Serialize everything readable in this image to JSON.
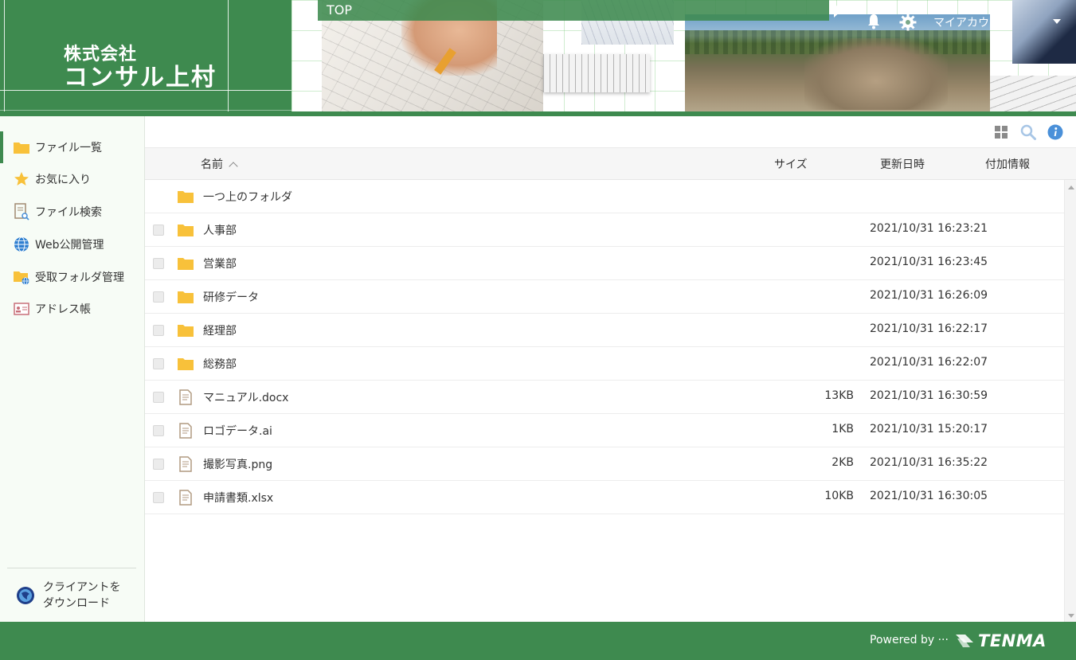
{
  "header": {
    "logo_line1": "株式会社",
    "logo_line2": "コンサル上村",
    "breadcrumb": "TOP",
    "account_label": "マイアカウント"
  },
  "toolbar": {
    "icons": [
      "grid-view-icon",
      "search-icon",
      "info-icon"
    ]
  },
  "sidebar": {
    "items": [
      {
        "label": "ファイル一覧",
        "icon": "folder-icon",
        "active": true
      },
      {
        "label": "お気に入り",
        "icon": "star-icon",
        "active": false
      },
      {
        "label": "ファイル検索",
        "icon": "file-search-icon",
        "active": false
      },
      {
        "label": "Web公開管理",
        "icon": "globe-icon",
        "active": false
      },
      {
        "label": "受取フォルダ管理",
        "icon": "inbox-folder-icon",
        "active": false
      },
      {
        "label": "アドレス帳",
        "icon": "address-book-icon",
        "active": false
      }
    ],
    "client_download_line1": "クライアントを",
    "client_download_line2": "ダウンロード"
  },
  "table": {
    "headers": {
      "name": "名前",
      "size": "サイズ",
      "updated": "更新日時",
      "extra": "付加情報"
    },
    "parent_folder": "一つ上のフォルダ",
    "rows": [
      {
        "type": "folder",
        "name": "人事部",
        "size": "",
        "updated": "2021/10/31 16:23:21"
      },
      {
        "type": "folder",
        "name": "営業部",
        "size": "",
        "updated": "2021/10/31 16:23:45"
      },
      {
        "type": "folder",
        "name": "研修データ",
        "size": "",
        "updated": "2021/10/31 16:26:09"
      },
      {
        "type": "folder",
        "name": "経理部",
        "size": "",
        "updated": "2021/10/31 16:22:17"
      },
      {
        "type": "folder",
        "name": "総務部",
        "size": "",
        "updated": "2021/10/31 16:22:07"
      },
      {
        "type": "file",
        "name": "マニュアル.docx",
        "size": "13KB",
        "updated": "2021/10/31 16:30:59"
      },
      {
        "type": "file",
        "name": "ロゴデータ.ai",
        "size": "1KB",
        "updated": "2021/10/31 15:20:17"
      },
      {
        "type": "file",
        "name": "撮影写真.png",
        "size": "2KB",
        "updated": "2021/10/31 16:35:22"
      },
      {
        "type": "file",
        "name": "申請書類.xlsx",
        "size": "10KB",
        "updated": "2021/10/31 16:30:05"
      }
    ]
  },
  "footer": {
    "powered_by": "Powered by ···",
    "brand": "TENMA"
  },
  "colors": {
    "brand_green": "#3e8a4f",
    "folder_yellow": "#f8c13a",
    "info_blue": "#4a90d9"
  }
}
